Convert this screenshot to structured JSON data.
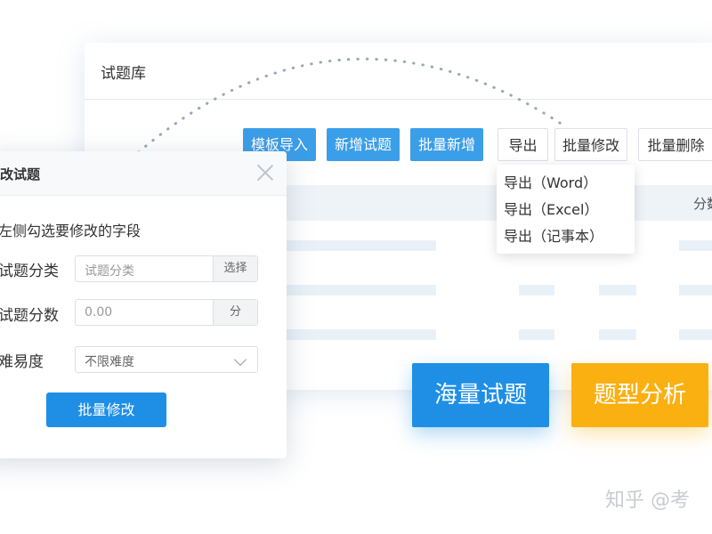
{
  "main": {
    "title": "试题库",
    "toolbar": [
      {
        "label": "模板导入",
        "style": "blue"
      },
      {
        "label": "新增试题",
        "style": "blue"
      },
      {
        "label": "批量新增",
        "style": "blue"
      },
      {
        "label": "导出",
        "style": "white"
      },
      {
        "label": "批量修改",
        "style": "white"
      },
      {
        "label": "批量删除",
        "style": "white"
      }
    ],
    "table_header_right": "分数"
  },
  "export_dropdown": {
    "items": [
      "导出（Word）",
      "导出（Excel）",
      "导出（记事本）"
    ]
  },
  "feature_tiles": [
    {
      "label": "海量试题",
      "color": "#1f8fe6"
    },
    {
      "label": "题型分析",
      "color": "#fbb012"
    }
  ],
  "modal": {
    "title": "改试题",
    "hint": "左侧勾选要修改的字段",
    "fields": [
      {
        "label": "试题分类",
        "placeholder": "试题分类",
        "suffix": "选择"
      },
      {
        "label": "试题分数",
        "placeholder": "0.00",
        "suffix": "分"
      },
      {
        "label": "难易度",
        "value": "不限难度",
        "type": "select"
      }
    ],
    "submit_label": "批量修改",
    "close_icon": "close-icon"
  },
  "watermark": "知乎 @考",
  "colors": {
    "primary": "#1f8fe6",
    "button_blue": "#3b9ee8",
    "accent_orange": "#fbb012",
    "header_bg": "#eef3f8"
  }
}
